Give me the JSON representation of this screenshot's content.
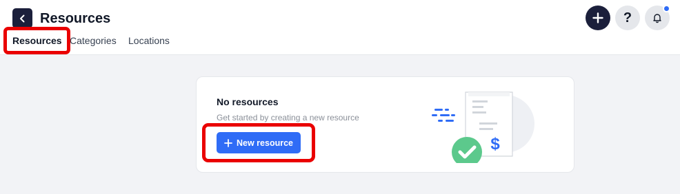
{
  "header": {
    "title": "Resources",
    "back_icon": "chevron-left-icon"
  },
  "tabs": [
    {
      "label": "Resources",
      "active": true
    },
    {
      "label": "Categories",
      "active": false
    },
    {
      "label": "Locations",
      "active": false
    }
  ],
  "actions": {
    "add_icon": "plus-icon",
    "help_label": "?",
    "bell_icon": "bell-icon",
    "has_notification": true
  },
  "empty_state": {
    "title": "No resources",
    "subtitle": "Get started by creating a new resource",
    "button_label": "New resource",
    "button_icon": "plus-icon",
    "illustration": "receipt-dollar-checkmark-illustration"
  },
  "colors": {
    "primary": "#2f6cf6",
    "dark": "#1b1f3b",
    "highlight": "#ea0000",
    "success": "#5cc98c"
  }
}
